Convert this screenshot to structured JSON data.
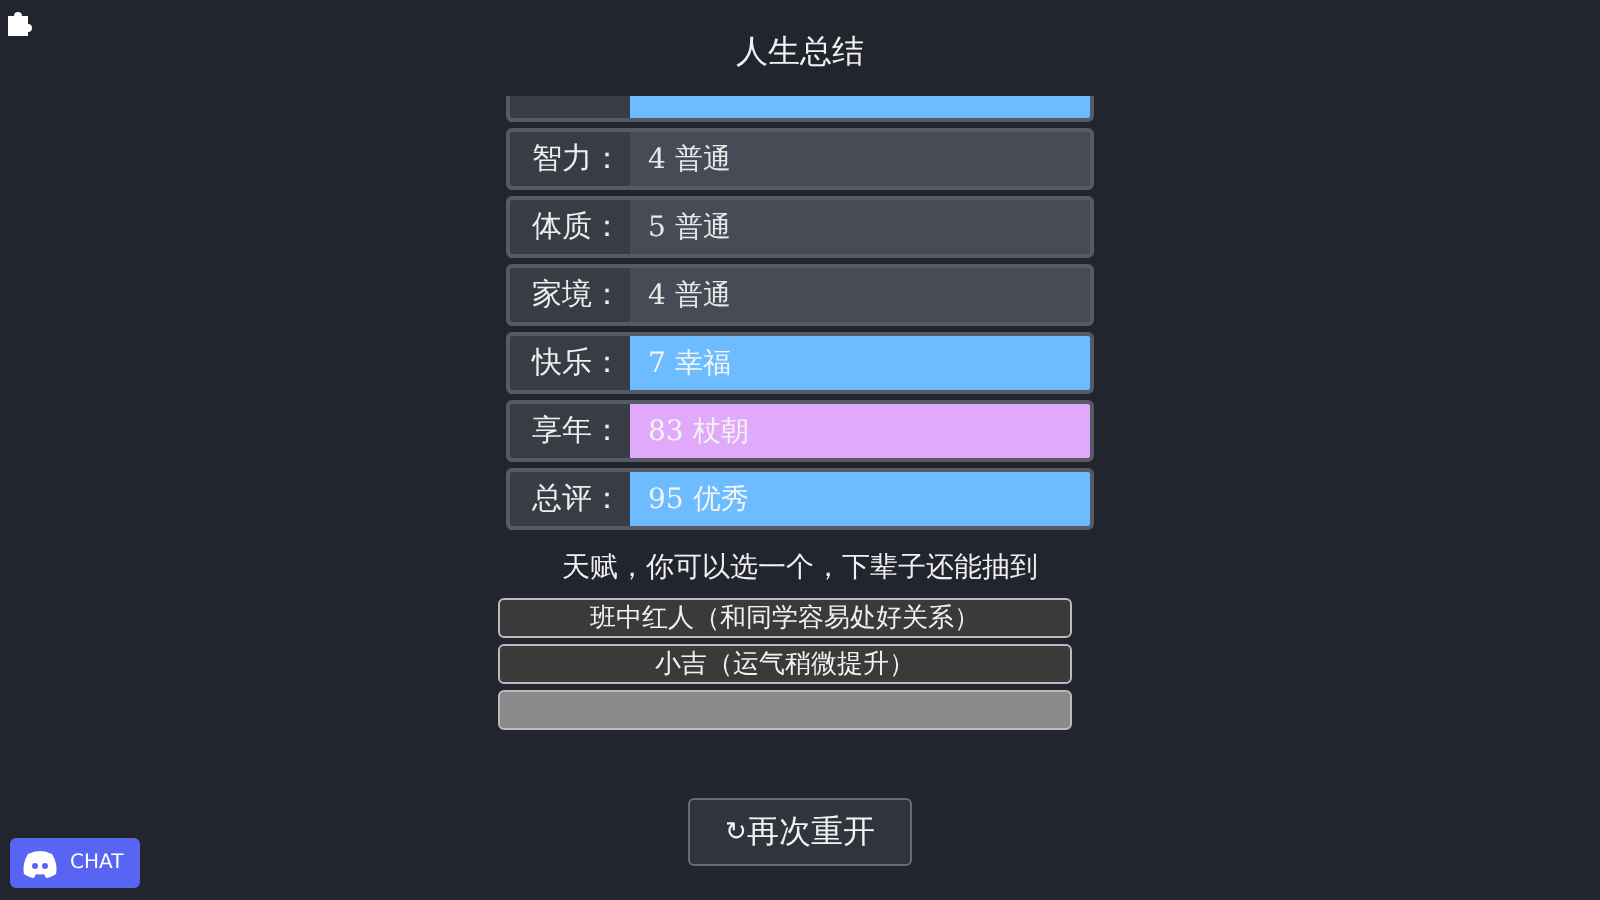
{
  "title": "人生总结",
  "stats": [
    {
      "color": "#6cbcff"
    },
    {
      "label": "智力：",
      "value": "4 普通",
      "color": "#464b55"
    },
    {
      "label": "体质：",
      "value": "5 普通",
      "color": "#464b55"
    },
    {
      "label": "家境：",
      "value": "4 普通",
      "color": "#464b55"
    },
    {
      "label": "快乐：",
      "value": "7 幸福",
      "color": "#6cbcff"
    },
    {
      "label": "享年：",
      "value": "83 杖朝",
      "color": "#e0a9fb"
    },
    {
      "label": "总评：",
      "value": "95 优秀",
      "color": "#6cbcff"
    }
  ],
  "talent_prompt": "天赋，你可以选一个，下辈子还能抽到",
  "talents": [
    {
      "label": "班中红人（和同学容易处好关系）",
      "disabled": false
    },
    {
      "label": "小吉（运气稍微提升）",
      "disabled": false
    },
    {
      "disabled": true
    }
  ],
  "restart_button": {
    "icon": "↻",
    "label": "再次重开"
  },
  "chat_button": {
    "label": "CHAT"
  }
}
